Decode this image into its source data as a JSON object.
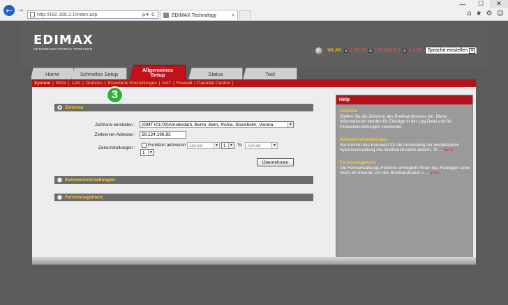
{
  "browser": {
    "url": "http://192.168.2.1/index.asp",
    "tab_title": "EDIMAX Technology",
    "tab_close": "×",
    "address_controls": "ρ▾ C",
    "window_controls": {
      "minimize": "—",
      "maximize": "☐",
      "close": "✕"
    },
    "toolbar_icons": [
      "home-icon",
      "star-icon",
      "gear-icon",
      "smiley-icon"
    ]
  },
  "header": {
    "logo": "EDIMAX",
    "tagline": "NETWORKING PEOPLE TOGETHER",
    "status": {
      "wlan_label": "WLAN",
      "firmware_value": "2.25.08",
      "ip_value": "192.168.2.1",
      "version_value": "v.1.28"
    },
    "language": "Sprache einstellen"
  },
  "nav": {
    "tabs": [
      "Home",
      "Schnelles Setup",
      "Allgemeines Setup",
      "Status",
      "Tool"
    ],
    "active_tab": "Allgemeines Setup",
    "active_line1": "Allgemeines",
    "active_line2": "Setup"
  },
  "subnav": [
    "System",
    "WAN",
    "LAN",
    "Drahtlos",
    "Erweiterte Einstellungen",
    "NAT",
    "Firewall",
    "Parental Control"
  ],
  "step_badge": "3",
  "sections": {
    "zeitzone": {
      "title": "Zeitzone",
      "tz_label": "Zeitzone einstellen :",
      "tz_value": "(GMT+01:00)Amsterdam, Berlin, Bern, Rome, Stockholm, Vienna",
      "server_label": "Zeitserver-Adresse :",
      "server_value": "59.124.196.83",
      "dst_label": "Zeitumstellungen :",
      "dst_checkbox_label": "Funktion aktivieren",
      "from_month": "Januar",
      "from_day": "1",
      "to_label": "To",
      "to_month": "Januar",
      "to_day": "1",
      "apply_button": "Übernehmen"
    },
    "kennwort": {
      "title": "Kennworteinstellungen"
    },
    "fernmanagement": {
      "title": "Fernmanagement"
    }
  },
  "help": {
    "title": "Help",
    "sections": [
      {
        "title": "Zeitzone",
        "text": "Stellen Sie die Zeitzone des Breitbandrouters ein. Diese Informationen werden für Einträge in der Log-Datei und für Firewalleinstellungen verwendet."
      },
      {
        "title": "Kennworteinstellungen",
        "text": "Sie können das Kennwort für die Anmeldung der webbasierten Systemverwaltung des Breitbandrouters ändern. St ....",
        "more": "more"
      },
      {
        "title": "Fernmanagement",
        "text": "Die Fernverwaltungs-Funktion ermöglicht Ihnen das Festlegen eines Hosts im Internet, um den Breitbandrouter v ....",
        "more": "more"
      }
    ]
  }
}
